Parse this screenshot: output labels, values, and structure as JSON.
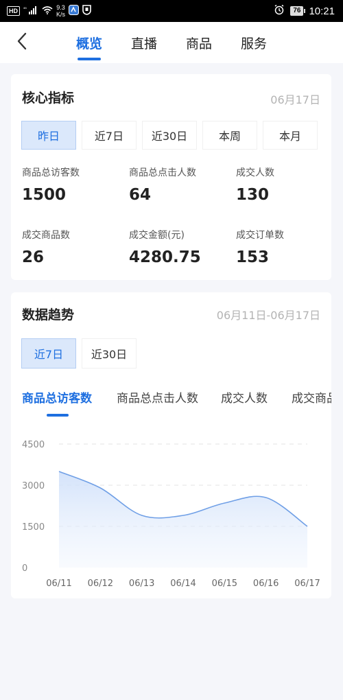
{
  "status_bar": {
    "left_badge": "HD",
    "signal_label": "⁴⁶",
    "speed_value": "9.3",
    "speed_unit": "K/s",
    "battery": "76",
    "time": "10:21"
  },
  "nav": {
    "tabs": [
      {
        "label": "概览",
        "active": true
      },
      {
        "label": "直播",
        "active": false
      },
      {
        "label": "商品",
        "active": false
      },
      {
        "label": "服务",
        "active": false
      }
    ]
  },
  "core": {
    "title": "核心指标",
    "date": "06月17日",
    "ranges": [
      {
        "label": "昨日",
        "active": true
      },
      {
        "label": "近7日",
        "active": false
      },
      {
        "label": "近30日",
        "active": false
      },
      {
        "label": "本周",
        "active": false
      },
      {
        "label": "本月",
        "active": false
      }
    ],
    "metrics": [
      {
        "label": "商品总访客数",
        "value": "1500"
      },
      {
        "label": "商品总点击人数",
        "value": "64"
      },
      {
        "label": "成交人数",
        "value": "130"
      },
      {
        "label": "成交商品数",
        "value": "26"
      },
      {
        "label": "成交金额(元)",
        "value": "4280.75"
      },
      {
        "label": "成交订单数",
        "value": "153"
      }
    ]
  },
  "trend": {
    "title": "数据趋势",
    "date_range": "06月11日-06月17日",
    "ranges": [
      {
        "label": "近7日",
        "active": true
      },
      {
        "label": "近30日",
        "active": false
      }
    ],
    "metric_tabs": [
      {
        "label": "商品总访客数",
        "active": true
      },
      {
        "label": "商品总点击人数",
        "active": false
      },
      {
        "label": "成交人数",
        "active": false
      },
      {
        "label": "成交商品数",
        "active": false
      }
    ]
  },
  "chart_data": {
    "type": "area",
    "categories": [
      "06/11",
      "06/12",
      "06/13",
      "06/14",
      "06/15",
      "06/16",
      "06/17"
    ],
    "series": [
      {
        "values": [
          3500,
          2900,
          1900,
          1900,
          2350,
          2550,
          1500
        ]
      }
    ],
    "ylim": [
      0,
      4500
    ],
    "yticks": [
      "0",
      "1500",
      "3000",
      "4500"
    ],
    "grid": true,
    "colors": {
      "line": "#6f9fe6",
      "fill": "#dce8fb"
    }
  }
}
